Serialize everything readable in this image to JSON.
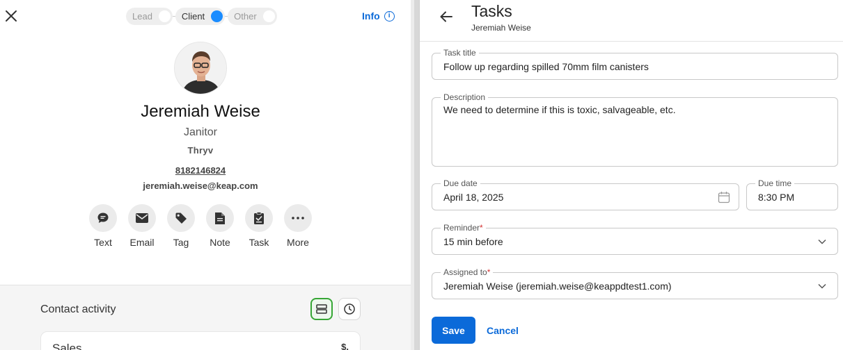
{
  "contact_panel": {
    "close_icon": "close-icon",
    "stages": [
      {
        "label": "Lead",
        "active": false
      },
      {
        "label": "Client",
        "active": true
      },
      {
        "label": "Other",
        "active": false
      }
    ],
    "info_label": "Info",
    "info_icon": "info-circle-icon",
    "name": "Jeremiah Weise",
    "job_title": "Janitor",
    "company": "Thryv",
    "phone": "8182146824",
    "email": "jeremiah.weise@keap.com",
    "actions": [
      {
        "label": "Text",
        "icon": "chat-bubble-icon"
      },
      {
        "label": "Email",
        "icon": "envelope-icon"
      },
      {
        "label": "Tag",
        "icon": "tag-icon"
      },
      {
        "label": "Note",
        "icon": "note-icon"
      },
      {
        "label": "Task",
        "icon": "task-checklist-icon"
      },
      {
        "label": "More",
        "icon": "more-horizontal-icon"
      }
    ],
    "activity": {
      "title": "Contact activity",
      "list_view_icon": "list-view-icon",
      "history_icon": "clock-icon",
      "card_title": "Sales",
      "card_icon_text": "$."
    }
  },
  "task_panel": {
    "title": "Tasks",
    "subtitle": "Jeremiah Weise",
    "back_icon": "arrow-left-icon",
    "fields": {
      "task_title": {
        "label": "Task title",
        "value": "Follow up regarding spilled 70mm film canisters"
      },
      "description": {
        "label": "Description",
        "value": "We need to determine if this is toxic, salvageable, etc."
      },
      "due_date": {
        "label": "Due date",
        "value": "April 18, 2025",
        "icon": "calendar-icon"
      },
      "due_time": {
        "label": "Due time",
        "value": "8:30 PM"
      },
      "reminder": {
        "label": "Reminder",
        "required_mark": "*",
        "value": "15 min before",
        "icon": "chevron-down-icon"
      },
      "assigned_to": {
        "label": "Assigned to",
        "required_mark": "*",
        "value": "Jeremiah Weise (jeremiah.weise@keappdtest1.com)",
        "icon": "chevron-down-icon"
      }
    },
    "save_label": "Save",
    "cancel_label": "Cancel"
  },
  "colors": {
    "accent_blue": "#0b6ad9",
    "active_stage_dot": "#1a8cff",
    "selected_green": "#36a635",
    "required_red": "#d32f2f"
  }
}
